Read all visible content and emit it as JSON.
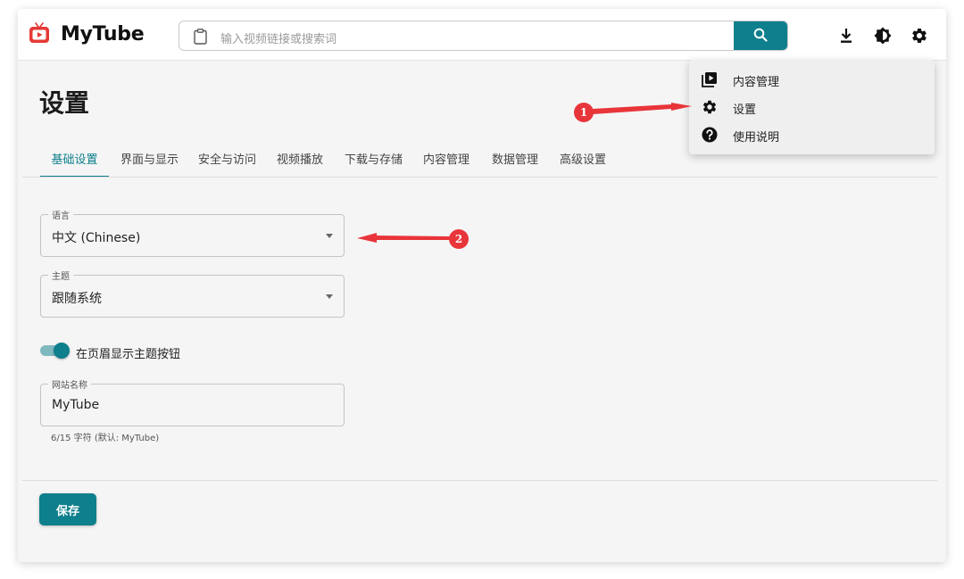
{
  "app": {
    "name": "MyTube"
  },
  "search": {
    "placeholder": "输入视频链接或搜索词"
  },
  "page": {
    "title": "设置"
  },
  "tabs": [
    {
      "label": "基础设置",
      "active": true
    },
    {
      "label": "界面与显示",
      "active": false
    },
    {
      "label": "安全与访问",
      "active": false
    },
    {
      "label": "视频播放",
      "active": false
    },
    {
      "label": "下载与存储",
      "active": false
    },
    {
      "label": "内容管理",
      "active": false
    },
    {
      "label": "数据管理",
      "active": false
    },
    {
      "label": "高级设置",
      "active": false
    }
  ],
  "form": {
    "language": {
      "label": "语言",
      "value": "中文 (Chinese)"
    },
    "theme": {
      "label": "主题",
      "value": "跟随系统"
    },
    "header_theme_toggle": {
      "label": "在页眉显示主题按钮",
      "checked": true
    },
    "site_name": {
      "label": "网站名称",
      "value": "MyTube",
      "helper": "6/15 字符 (默认: MyTube)"
    }
  },
  "save_label": "保存",
  "settings_menu": {
    "items": [
      {
        "label": "内容管理",
        "icon": "video-library-icon"
      },
      {
        "label": "设置",
        "icon": "gear-icon"
      },
      {
        "label": "使用说明",
        "icon": "help-icon"
      }
    ]
  },
  "annotations": [
    {
      "number": "1"
    },
    {
      "number": "2"
    }
  ],
  "colors": {
    "accent": "#0e7f8c",
    "annotation": "#e8353a",
    "logo_red": "#e53935"
  }
}
